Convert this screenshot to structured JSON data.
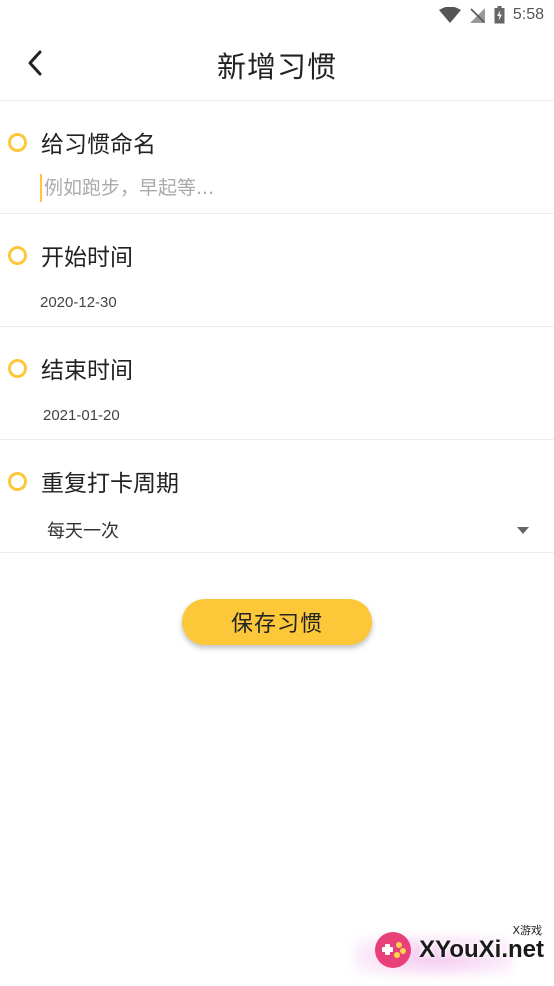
{
  "status_bar": {
    "time": "5:58",
    "icons": [
      "wifi-icon",
      "signal-icon",
      "battery-icon"
    ]
  },
  "app_bar": {
    "back_icon": "back-arrow-icon",
    "title": "新增习惯"
  },
  "form": {
    "name": {
      "label": "给习惯命名",
      "placeholder": "例如跑步，早起等...",
      "value": ""
    },
    "start_time": {
      "label": "开始时间",
      "value": "2020-12-30"
    },
    "end_time": {
      "label": "结束时间",
      "value": "2021-01-20"
    },
    "repeat": {
      "label": "重复打卡周期",
      "selected": "每天一次"
    }
  },
  "actions": {
    "save_label": "保存习惯"
  },
  "watermark": {
    "text": "XYouXi.net",
    "sub": "X游戏"
  },
  "colors": {
    "accent": "#fcc83a",
    "divider": "#eeeeee",
    "text": "#222222",
    "placeholder": "#aaaaaa"
  }
}
